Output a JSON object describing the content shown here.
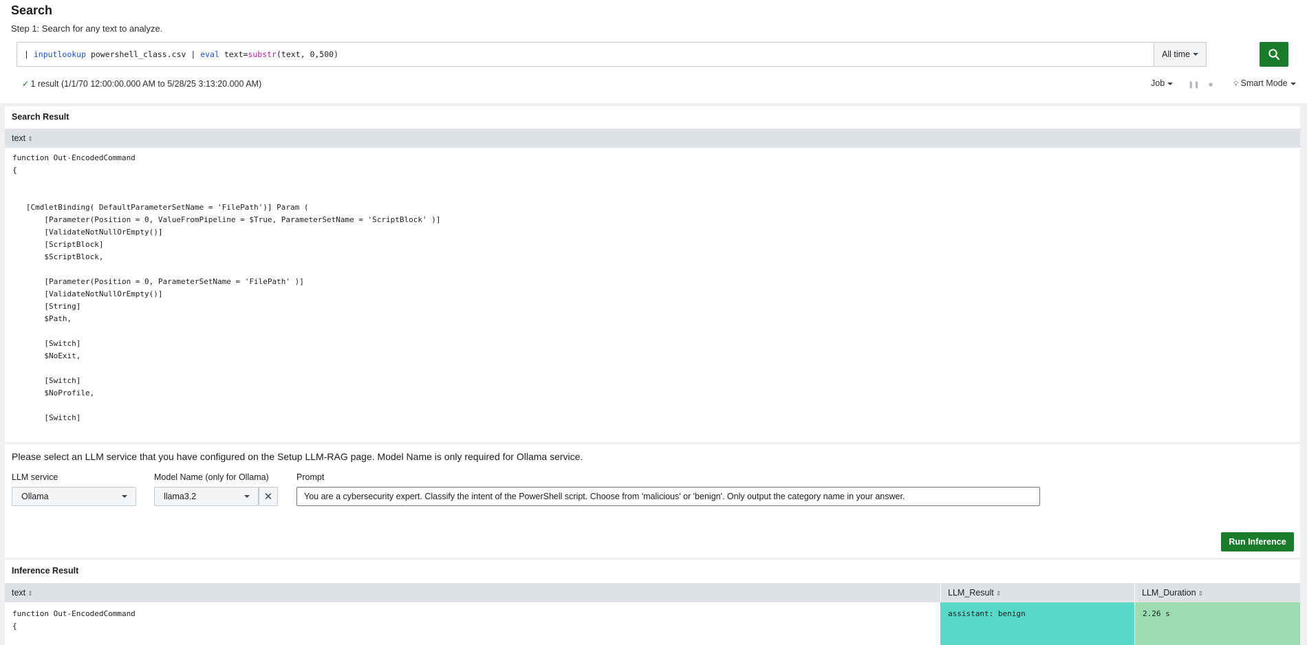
{
  "header": {
    "title": "Search",
    "step": "Step 1: Search for any text to analyze."
  },
  "search": {
    "query_parts": {
      "pipe": "| ",
      "cmd1": "inputlookup",
      "arg1": " powershell_class.csv | ",
      "cmd2": "eval",
      "arg2": " text=",
      "fn": "substr",
      "arg3": "(text, 0,500)"
    },
    "time_range": "All time",
    "submit_icon": "search-icon"
  },
  "status": {
    "check_icon": "✓",
    "text": "1 result (1/1/70 12:00:00.000 AM to 5/28/25 3:13:20.000 AM)",
    "job_label": "Job",
    "mode_label": "Smart Mode"
  },
  "search_result": {
    "title": "Search Result",
    "column": "text",
    "code": "function Out-EncodedCommand\n{\n\n\n   [CmdletBinding( DefaultParameterSetName = 'FilePath')] Param (\n       [Parameter(Position = 0, ValueFromPipeline = $True, ParameterSetName = 'ScriptBlock' )]\n       [ValidateNotNullOrEmpty()]\n       [ScriptBlock]\n       $ScriptBlock,\n\n       [Parameter(Position = 0, ParameterSetName = 'FilePath' )]\n       [ValidateNotNullOrEmpty()]\n       [String]\n       $Path,\n\n       [Switch]\n       $NoExit,\n\n       [Switch]\n       $NoProfile,\n\n       [Switch]"
  },
  "llm": {
    "intro": "Please select an LLM service that you have configured on the Setup LLM-RAG page. Model Name is only required for Ollama service.",
    "service_label": "LLM service",
    "service_value": "Ollama",
    "model_label": "Model Name (only for Ollama)",
    "model_value": "llama3.2",
    "clear_symbol": "✕",
    "prompt_label": "Prompt",
    "prompt_value": "You are a cybersecurity expert. Classify the intent of the PowerShell script. Choose from 'malicious' or 'benign'. Only output the category name in your answer.",
    "run_label": "Run Inference"
  },
  "inference": {
    "title": "Inference Result",
    "columns": [
      "text",
      "LLM_Result",
      "LLM_Duration"
    ],
    "row": {
      "text": "function Out-EncodedCommand\n{",
      "llm_result": "assistant: benign",
      "llm_duration": "2.26 s"
    },
    "colors": {
      "result_cell": "#58d8c6",
      "duration_cell": "#9bddb0",
      "primary_button": "#1a7c2b"
    }
  }
}
